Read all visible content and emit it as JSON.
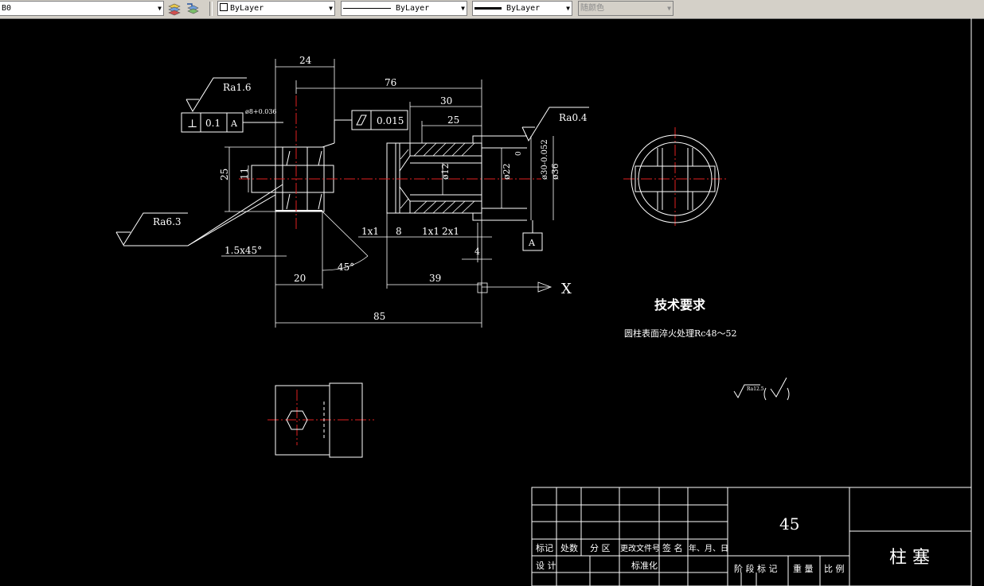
{
  "toolbar": {
    "layer_value": "B0",
    "color_value": "ByLayer",
    "linetype_value": "ByLayer",
    "lineweight_value": "ByLayer",
    "plotstyle_value": "随颜色",
    "icons": [
      "layer-manager-icon",
      "layer-previous-icon"
    ]
  },
  "drawing": {
    "dims": {
      "d24": "24",
      "d76": "76",
      "d30": "30",
      "d25": "25",
      "d25v": "25",
      "d11v": "11",
      "phi12": "ø12",
      "phi22": "ø22",
      "phi30": "ø30-0.052",
      "phi30_top": "0",
      "phi36": "ø36",
      "d1x1a": "1x1",
      "d8": "8",
      "d1x1b": "1x1",
      "d2x1": "2x1",
      "d4": "4",
      "chamfer": "1.5x45°",
      "angle45": "45°",
      "d20": "20",
      "d39": "39",
      "d85": "85",
      "hole_dim": "ø8+0.036"
    },
    "roughness": {
      "ra16": "Ra1.6",
      "ra04": "Ra0.4",
      "ra63": "Ra6.3"
    },
    "gdt_perp": {
      "symbol": "⊥",
      "tolerance": "0.1",
      "datum": "A"
    },
    "gdt_cyl": {
      "tolerance": "0.015"
    },
    "datum_label": "A",
    "axis_label": "X",
    "tech_title": "技术要求",
    "tech_text": "圆柱表面淬火处理Rc48～52",
    "rough_note": "Ra12.5",
    "title_block": {
      "material": "45",
      "part_name": "柱 塞",
      "rev_headers": [
        "标记",
        "处数",
        "分 区",
        "更改文件号",
        "签 名",
        "年、月、日"
      ],
      "row_design": "设 计",
      "row_standard": "标准化",
      "stage_headers": [
        "阶 段 标 记",
        "重 量",
        "比 例"
      ]
    }
  }
}
